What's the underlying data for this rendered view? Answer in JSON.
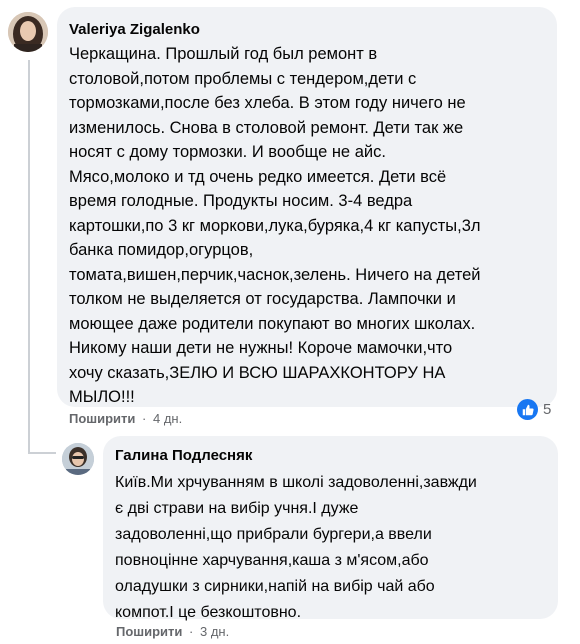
{
  "comments": [
    {
      "author": "Valeriya Zigalenko",
      "text": "Черкащина. Прошлый год был ремонт в\nстоловой,потом проблемы с тендером,дети с\nтормозками,после без хлеба. В этом году ничего не\nизменилось. Снова в столовой ремонт. Дети так же\nносят с дому тормозки. И вообще не айс.\nМясо,молоко и тд очень редко имеется. Дети всё\nвремя голодные. Продукты носим. 3-4 ведра\nкартошки,по 3 кг моркови,лука,буряка,4 кг капусты,3л\nбанка помидор,огурцов,\nтомата,вишен,перчик,часнок,зелень. Ничего на детей\nтолком не выделяется от государства. Лампочки и\nмоющее даже родители покупают во многих школах.\nНикому наши дети не нужны! Короче мамочки,что\nхочу сказать,ЗЕЛЮ И ВСЮ ШАРАХКОНТОРУ НА\nМЫЛО!!!",
      "share_label": "Поширити",
      "separator": "·",
      "time": "4 дн.",
      "reaction_count": "5",
      "reaction_icon": "like-icon"
    },
    {
      "author": "Галина Подлесняк",
      "text": "Київ.Ми хрчуванням в школі задоволенні,завжди\nє дві страви на вибір учня.І дуже\nзадоволенні,що прибрали бургери,а ввели\nповноцінне харчування,каша з м'ясом,або\nоладушки з сирники,напій на вибір чай або\nкомпот.І це безкоштовно.",
      "share_label": "Поширити",
      "separator": "·",
      "time": "3 дн."
    }
  ],
  "colors": {
    "bubble": "#f0f2f5",
    "text": "#050505",
    "meta": "#65676b",
    "like": "#1877f2"
  }
}
